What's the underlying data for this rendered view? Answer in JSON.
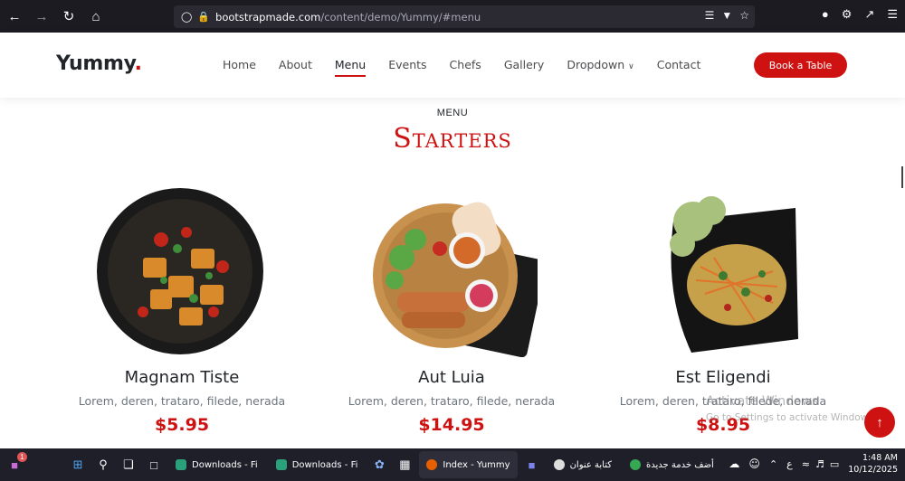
{
  "browser": {
    "url_host": "bootstrapmade.com",
    "url_path": "/content/demo/Yummy/#menu"
  },
  "header": {
    "logo_text": "Yummy",
    "logo_dot": ".",
    "nav": [
      {
        "label": "Home"
      },
      {
        "label": "About"
      },
      {
        "label": "Menu"
      },
      {
        "label": "Events"
      },
      {
        "label": "Chefs"
      },
      {
        "label": "Gallery"
      },
      {
        "label": "Dropdown"
      },
      {
        "label": "Contact"
      }
    ],
    "book_label": "Book a Table"
  },
  "section": {
    "label": "MENU",
    "title": "Starters"
  },
  "dishes": [
    {
      "name": "Magnam Tiste",
      "ingredients": "Lorem, deren, trataro, filede, nerada",
      "price": "$5.95"
    },
    {
      "name": "Aut Luia",
      "ingredients": "Lorem, deren, trataro, filede, nerada",
      "price": "$14.95"
    },
    {
      "name": "Est Eligendi",
      "ingredients": "Lorem, deren, trataro, filede, nerada",
      "price": "$8.95"
    }
  ],
  "watermark": {
    "line1": "Activate Windows",
    "line2": "Go to Settings to activate Windows."
  },
  "taskbar": {
    "apps": [
      {
        "label": "Downloads - Fi"
      },
      {
        "label": "Downloads - Fi"
      },
      {
        "label": "Index - Yummy"
      },
      {
        "label": "كتابة عنوان"
      },
      {
        "label": "أضف خدمة جديدة"
      }
    ],
    "lang": "ع",
    "time": "1:48 AM",
    "date": "10/12/2025",
    "badge": "1"
  },
  "colors": {
    "accent": "#ce1212",
    "browser_bg": "#1c1b22",
    "taskbar_bg": "#1f1f2a"
  }
}
